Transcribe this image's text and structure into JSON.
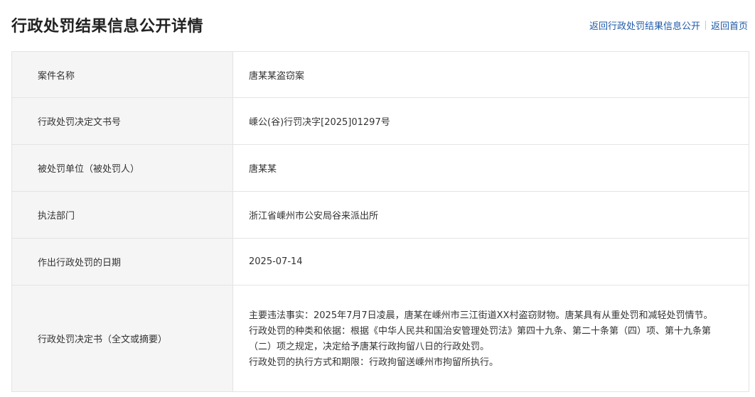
{
  "page": {
    "title": "行政处罚结果信息公开详情"
  },
  "nav": {
    "back_to_list": "返回行政处罚结果信息公开",
    "back_home": "返回首页"
  },
  "detail": {
    "rows": [
      {
        "label": "案件名称",
        "value": "唐某某盗窃案"
      },
      {
        "label": "行政处罚决定文书号",
        "value": "嵊公(谷)行罚决字[2025]01297号"
      },
      {
        "label": "被处罚单位（被处罚人）",
        "value": "唐某某"
      },
      {
        "label": "执法部门",
        "value": "浙江省嵊州市公安局谷来派出所"
      },
      {
        "label": "作出行政处罚的日期",
        "value": "2025-07-14"
      },
      {
        "label": "行政处罚决定书（全文或摘要）",
        "paragraphs": [
          "主要违法事实：2025年7月7日凌晨，唐某在嵊州市三江街道XX村盗窃财物。唐某具有从重处罚和减轻处罚情节。",
          "行政处罚的种类和依据：根据《中华人民共和国治安管理处罚法》第四十九条、第二十条第（四）项、第十九条第（二）项之规定，决定给予唐某行政拘留八日的行政处罚。",
          "行政处罚的执行方式和期限：行政拘留送嵊州市拘留所执行。"
        ]
      }
    ]
  },
  "colors": {
    "link": "#1e5aa8",
    "label_background": "#f5f5f5",
    "border": "#e4e4e4",
    "text": "#333333",
    "title": "#222222"
  }
}
